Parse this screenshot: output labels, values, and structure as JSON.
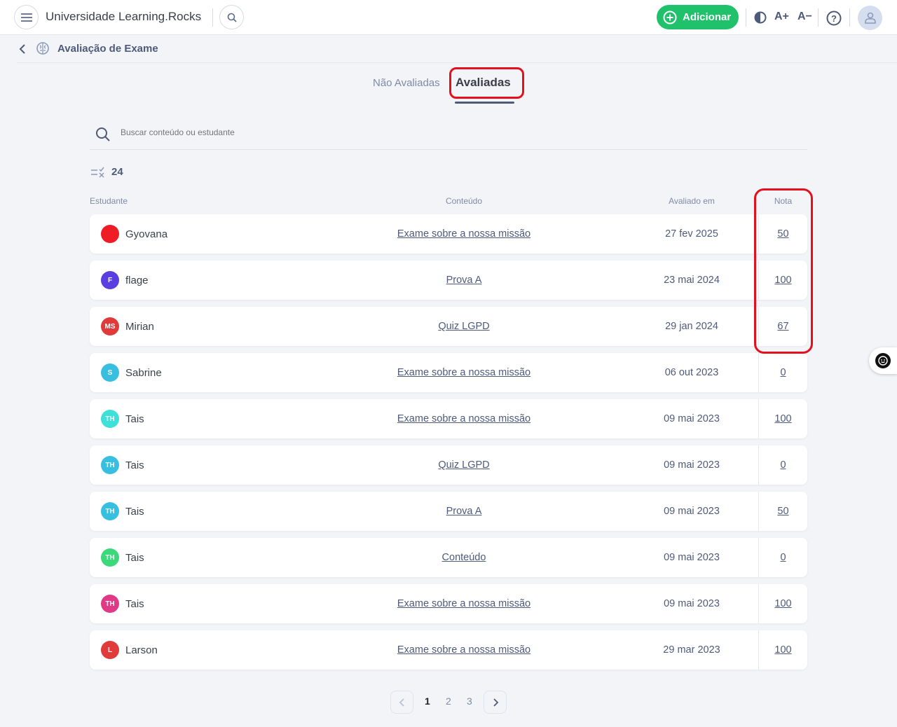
{
  "app": {
    "title": "Universidade Learning.Rocks",
    "add_label": "Adicionar",
    "font_up": "A+",
    "font_down": "A−"
  },
  "breadcrumb": {
    "title": "Avaliação de Exame"
  },
  "tabs": [
    {
      "label": "Não Avaliadas",
      "active": false
    },
    {
      "label": "Avaliadas",
      "active": true
    }
  ],
  "search": {
    "placeholder": "Buscar conteúdo ou estudante"
  },
  "count": "24",
  "columns": {
    "student": "Estudante",
    "content": "Conteúdo",
    "date": "Avaliado em",
    "grade": "Nota"
  },
  "rows": [
    {
      "initials": "",
      "color": "#ef1c25",
      "name": "Gyovana",
      "content": "Exame sobre a nossa missão",
      "date": "27 fev 2025",
      "grade": "50"
    },
    {
      "initials": "F",
      "color": "#5b3ee0",
      "name": "flage",
      "content": "Prova A",
      "date": "23 mai 2024",
      "grade": "100"
    },
    {
      "initials": "MS",
      "color": "#e03a3a",
      "name": "Mirian",
      "content": "Quiz LGPD",
      "date": "29 jan 2024",
      "grade": "67"
    },
    {
      "initials": "S",
      "color": "#38bfe0",
      "name": "Sabrine",
      "content": "Exame sobre a nossa missão",
      "date": "06 out 2023",
      "grade": "0"
    },
    {
      "initials": "TH",
      "color": "#3ee0d8",
      "name": "Tais",
      "content": "Exame sobre a nossa missão",
      "date": "09 mai 2023",
      "grade": "100"
    },
    {
      "initials": "TH",
      "color": "#38bfe0",
      "name": "Tais",
      "content": "Quiz LGPD",
      "date": "09 mai 2023",
      "grade": "0"
    },
    {
      "initials": "TH",
      "color": "#38bfe0",
      "name": "Tais",
      "content": "Prova A",
      "date": "09 mai 2023",
      "grade": "50"
    },
    {
      "initials": "TH",
      "color": "#3cd97a",
      "name": "Tais",
      "content": "Conteúdo",
      "date": "09 mai 2023",
      "grade": "0"
    },
    {
      "initials": "TH",
      "color": "#e03a86",
      "name": "Tais",
      "content": "Exame sobre a nossa missão",
      "date": "09 mai 2023",
      "grade": "100"
    },
    {
      "initials": "L",
      "color": "#e03a3a",
      "name": "Larson",
      "content": "Exame sobre a nossa missão",
      "date": "29 mar 2023",
      "grade": "100"
    }
  ],
  "pagination": {
    "pages": [
      "1",
      "2",
      "3"
    ],
    "current": "1"
  }
}
